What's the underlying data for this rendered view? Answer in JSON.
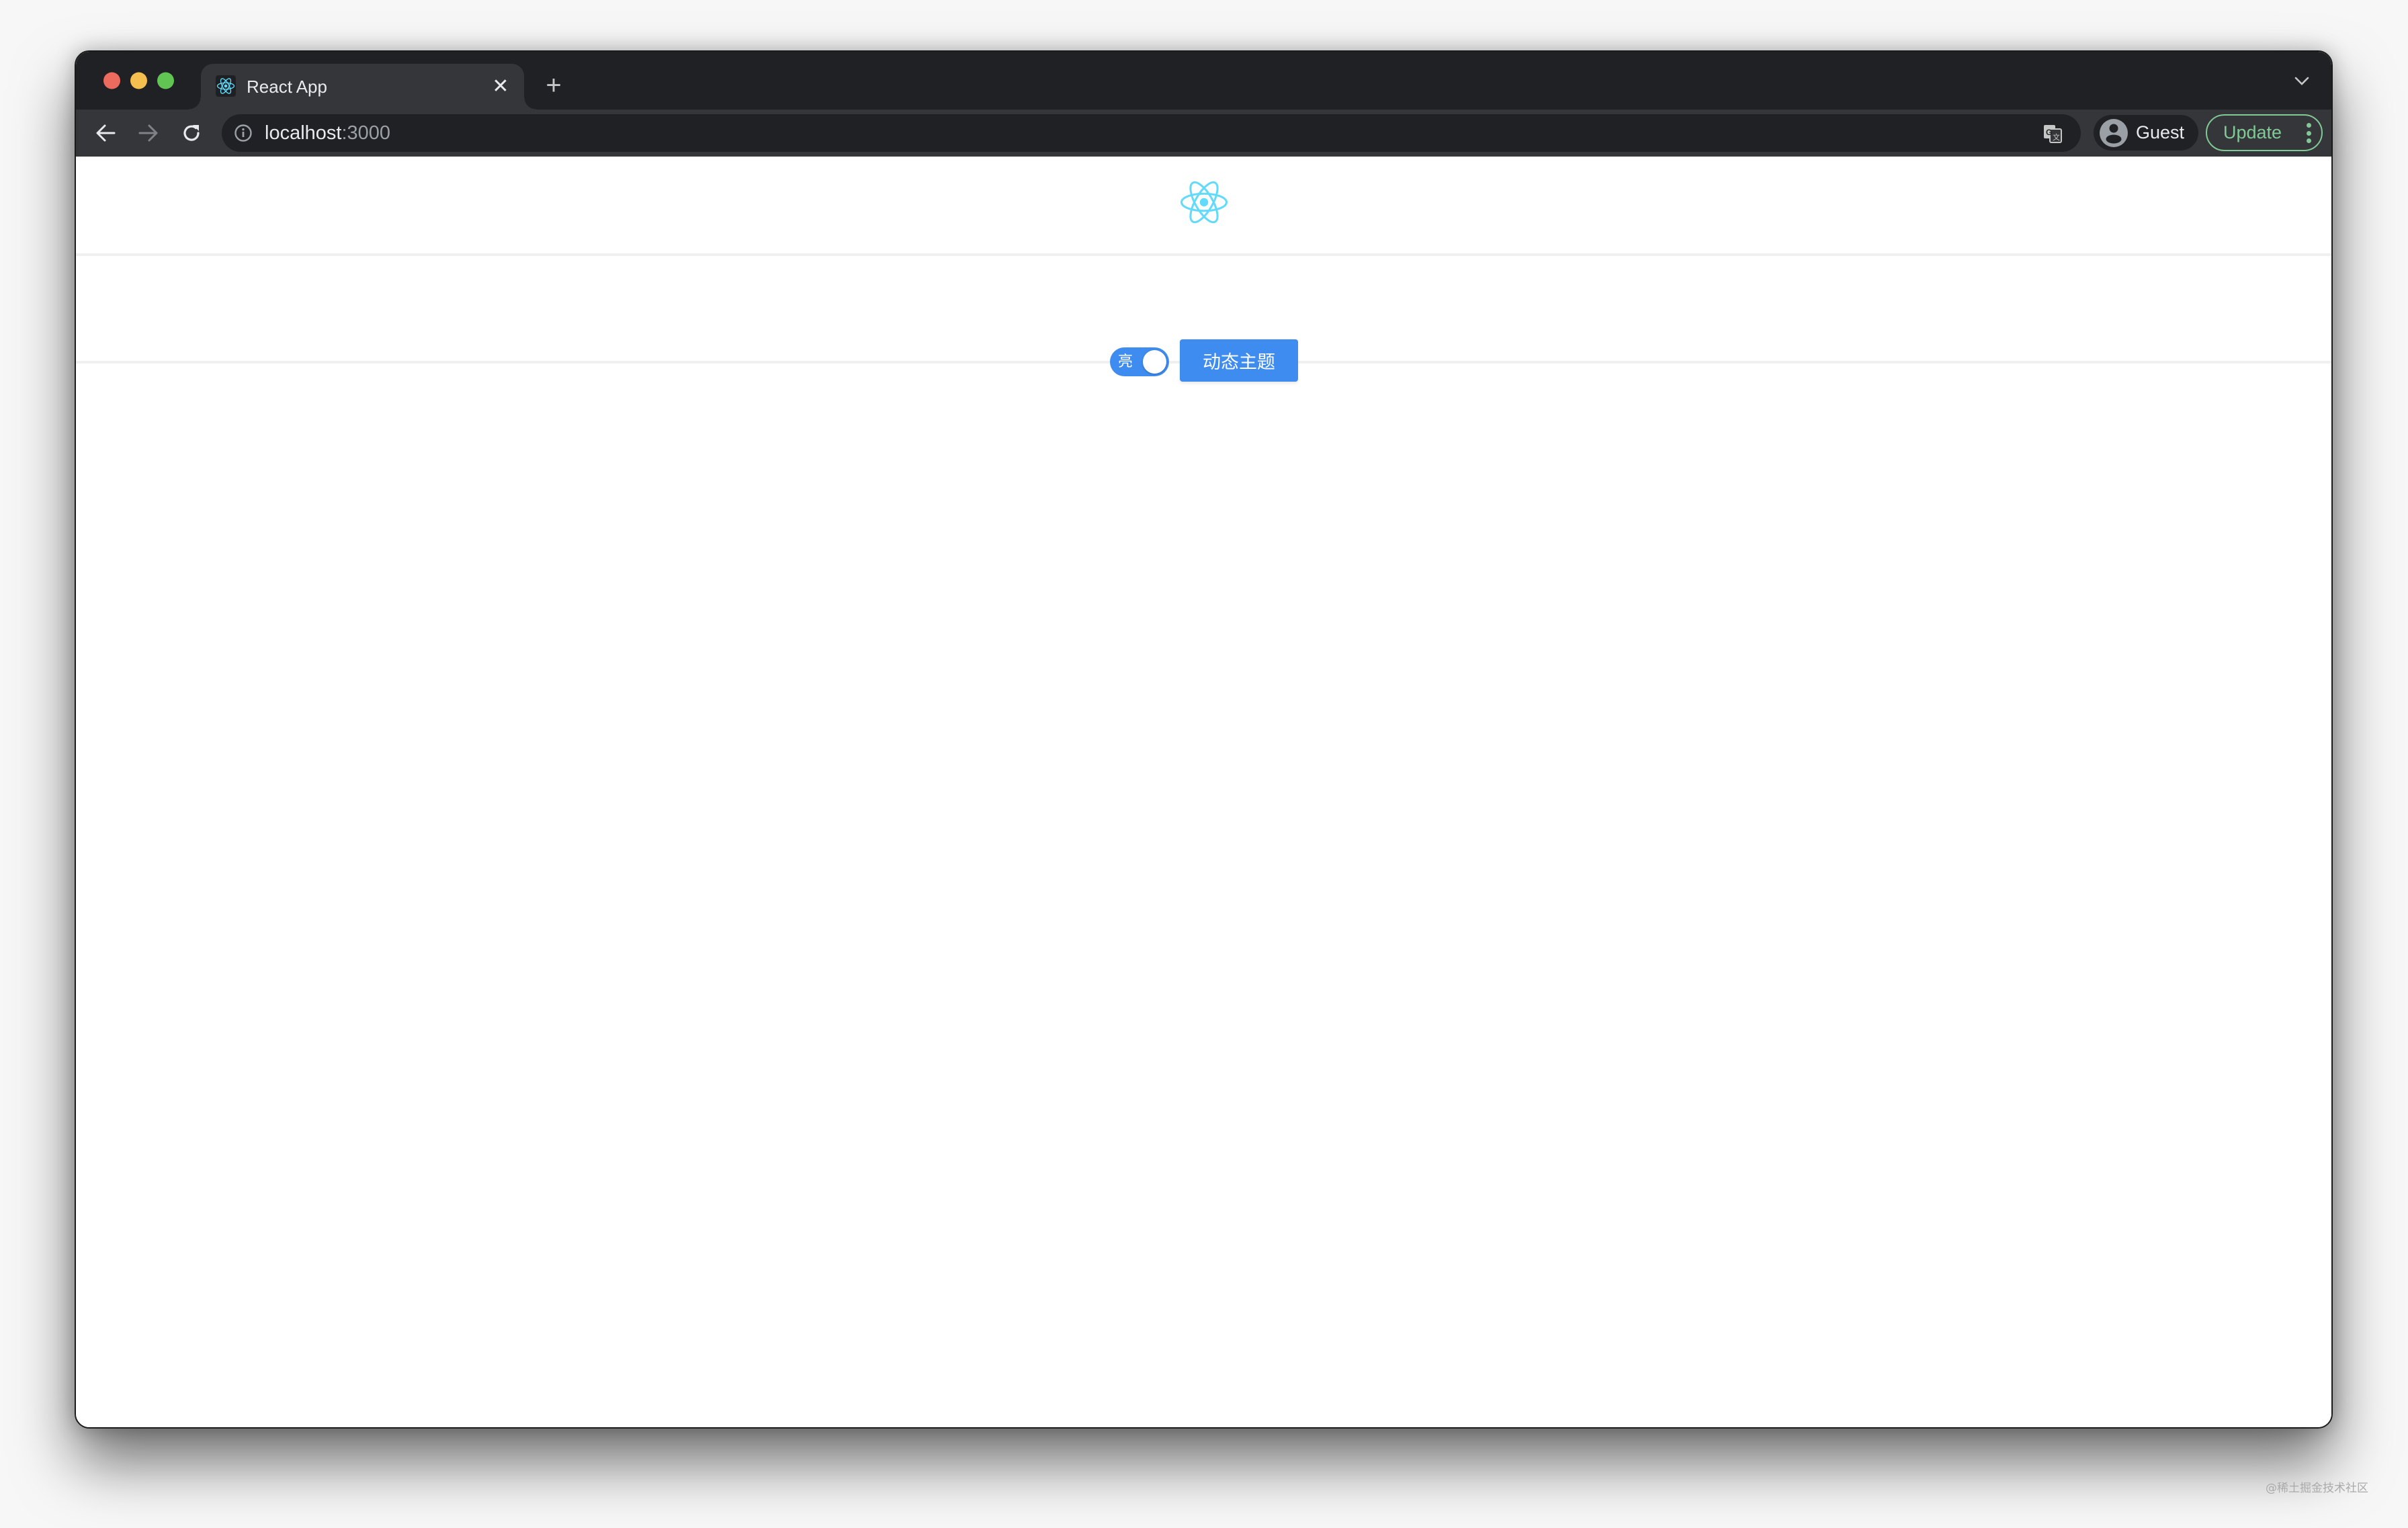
{
  "browser": {
    "tab": {
      "title": "React App",
      "favicon": "react-logo-icon",
      "close_icon": "close-icon"
    },
    "new_tab_icon": "plus-icon",
    "tab_search_icon": "chevron-down-icon",
    "toolbar": {
      "back_icon": "arrow-left-icon",
      "forward_icon": "arrow-right-icon",
      "reload_icon": "reload-icon",
      "site_info_icon": "info-icon",
      "url_host": "localhost",
      "url_port": ":3000",
      "translate_icon": "translate-icon",
      "profile": {
        "avatar_icon": "person-icon",
        "label": "Guest"
      },
      "update": {
        "label": "Update",
        "menu_icon": "more-vertical-icon"
      }
    },
    "colors": {
      "frame": "#202124",
      "toolbar": "#35363a",
      "update_accent": "#81c995"
    }
  },
  "page": {
    "logo": "react-logo-icon",
    "theme_switch": {
      "label": "亮",
      "checked": true
    },
    "theme_button": {
      "label": "动态主题"
    },
    "colors": {
      "primary": "#3f8cf0",
      "logo": "#61dafb",
      "divider": "#f0f0f0"
    }
  },
  "watermark": "@稀土掘金技术社区"
}
